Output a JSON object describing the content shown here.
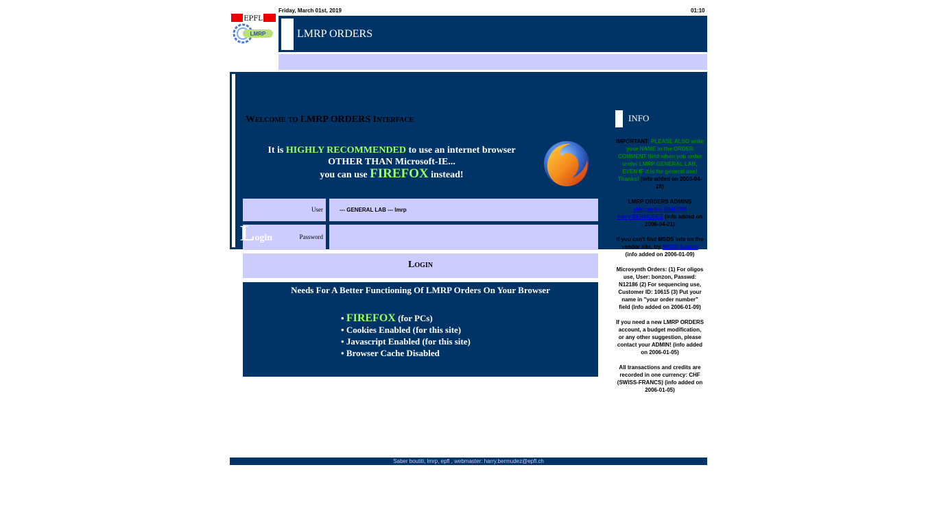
{
  "header": {
    "date": "Friday, March 01st, 2019",
    "time": "01:10",
    "title": "LMRP ORDERS",
    "logo_top_text": "EPFL",
    "logo_bottom_text": "LMRP"
  },
  "main": {
    "welcome": "Welcome to LMRP ORDERS Interface",
    "recommend": {
      "part1": "It is ",
      "highlight": "HIGHLY RECOMMENDED",
      "part2": " to use an internet browser",
      "line2": "OTHER THAN Microsoft-IE...",
      "line3_pre": "you can use ",
      "firefox": "FIREFOX",
      "line3_post": " instead!"
    },
    "login": {
      "side_big": "L",
      "side_small": "ogin",
      "user_label": "User",
      "user_value": "--- GENERAL LAB --- lmrp",
      "password_label": "Password",
      "password_value": "",
      "button_label": "Login"
    },
    "needs": {
      "title": "Needs For A Better Functioning Of LMRP Orders On Your Browser",
      "items": [
        {
          "bullet": "• ",
          "strong": "FIREFOX",
          "text": " (for PCs)"
        },
        {
          "bullet": "• ",
          "strong": "",
          "text": "Cookies Enabled (for this site)"
        },
        {
          "bullet": "• ",
          "strong": "",
          "text": "Javascript Enabled (for this site)"
        },
        {
          "bullet": "• ",
          "strong": "",
          "text": "Browser Cache Disabled"
        }
      ]
    }
  },
  "info": {
    "title": "INFO",
    "messages": {
      "m1_prefix": "IMPORTANT: ",
      "m1_green": "PLEASE ALSO write your NAME in the ORDER COMMENT field when you order under LMRP GENERAL LAB, EVEN IF it is for general use! Thanks!",
      "m1_suffix": " (info added on 2006-04-28)",
      "m2_prefix": "LMRP ORDERS ADMINS",
      "m2_link1": "alessandro.SIMEONI",
      "m2_link2": "harry.BERMUDEZ",
      "m2_suffix": " (info added on 2006-04-21)",
      "m3_prefix": "If you can't find MSDS info on the vendor site, try ",
      "m3_link": "MSDS Search",
      "m3_suffix": " (info added on 2006-01-09)",
      "m4": "Microsynth Orders: (1) For oligos use, User: bonzon, Passwd: N12186 (2) For sequencing use, Customer ID: 10615 (3) Put your name in \"your order number\" field (info added on 2006-01-09)",
      "m5": "If you need a new LMRP ORDERS account, a budget modification, or any other suggestion, please contact your ADMIN! (info added on 2006-01-05)",
      "m6": "All transactions and credits are recorded in one currency: CHF (SWISS-FRANCS) (info added on 2006-01-05)"
    }
  },
  "footer": {
    "text": "Saber boutiti, lmrp, epfl , webmaster: harry.bermudez@epfl.ch"
  },
  "colors": {
    "navy": "#003366",
    "lavender": "#ccccff",
    "highlight_green": "#99ff66",
    "info_green": "#008800"
  },
  "icons": [
    "firefox-logo-icon",
    "epfl-logo-icon",
    "lmrp-logo-icon"
  ]
}
